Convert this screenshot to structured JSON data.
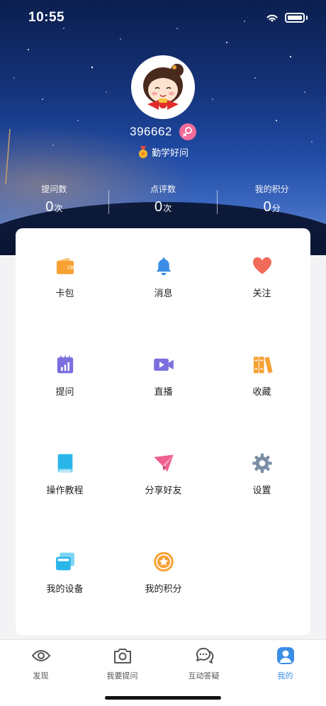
{
  "status_bar": {
    "time": "10:55"
  },
  "profile": {
    "username": "396662",
    "title": "勤学好问",
    "stats": [
      {
        "label": "提问数",
        "value": "0",
        "unit": "次"
      },
      {
        "label": "点评数",
        "value": "0",
        "unit": "次"
      },
      {
        "label": "我的积分",
        "value": "0",
        "unit": "分"
      }
    ]
  },
  "menu": [
    {
      "label": "卡包",
      "icon": "wallet-icon",
      "color": "#f7a134"
    },
    {
      "label": "消息",
      "icon": "bell-icon",
      "color": "#3b8de6"
    },
    {
      "label": "关注",
      "icon": "heart-icon",
      "color": "#f26a5a"
    },
    {
      "label": "提问",
      "icon": "calendar-chart-icon",
      "color": "#7b6fe0"
    },
    {
      "label": "直播",
      "icon": "video-camera-icon",
      "color": "#7b6fe0"
    },
    {
      "label": "收藏",
      "icon": "books-icon",
      "color": "#f7a134"
    },
    {
      "label": "操作教程",
      "icon": "book-icon",
      "color": "#2bb6ea"
    },
    {
      "label": "分享好友",
      "icon": "paper-plane-icon",
      "color": "#ee5f8f"
    },
    {
      "label": "设置",
      "icon": "gear-icon",
      "color": "#7c8da6"
    },
    {
      "label": "我的设备",
      "icon": "devices-icon",
      "color": "#2bb6ea"
    },
    {
      "label": "我的积分",
      "icon": "points-coin-icon",
      "color": "#f7a134"
    }
  ],
  "tabbar": [
    {
      "label": "发现",
      "icon": "eye-icon",
      "active": false
    },
    {
      "label": "我要提问",
      "icon": "camera-icon",
      "active": false
    },
    {
      "label": "互动答疑",
      "icon": "chat-bubbles-icon",
      "active": false
    },
    {
      "label": "我的",
      "icon": "user-icon",
      "active": true
    }
  ],
  "colors": {
    "accent": "#3b8de6",
    "female_badge": "#f36c9a"
  }
}
